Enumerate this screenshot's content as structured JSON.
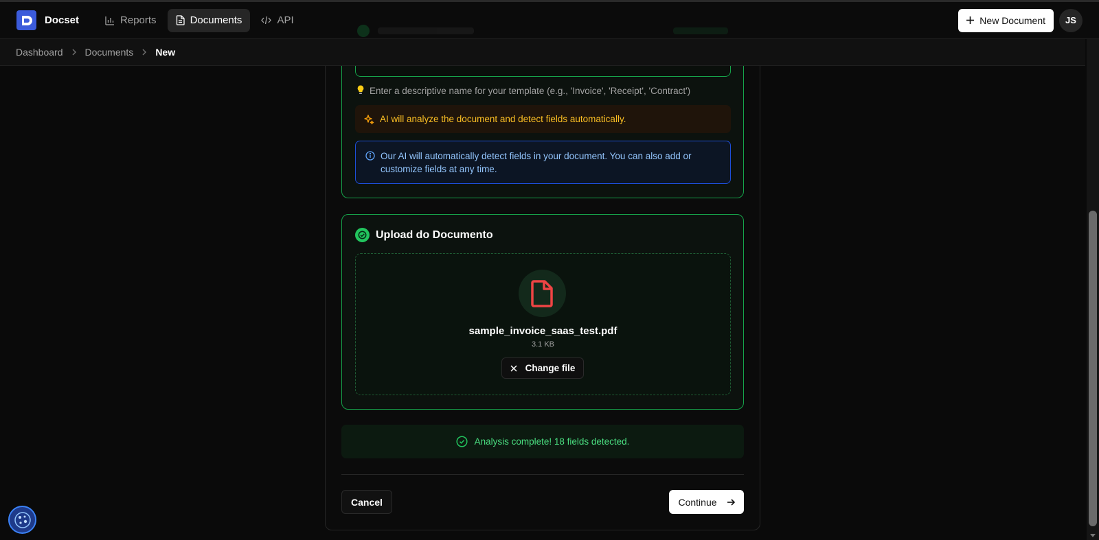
{
  "app": {
    "brand": "Docset",
    "logo_letter": "D"
  },
  "nav": {
    "items": [
      {
        "label": "Reports",
        "icon": "bar-chart-icon",
        "active": false
      },
      {
        "label": "Documents",
        "icon": "file-text-icon",
        "active": true
      },
      {
        "label": "API",
        "icon": "code-icon",
        "active": false
      }
    ],
    "new_document_label": "New Document",
    "avatar_initials": "JS"
  },
  "breadcrumb": {
    "items": [
      "Dashboard",
      "Documents"
    ],
    "current": "New"
  },
  "template_section": {
    "hint": "Enter a descriptive name for your template (e.g., 'Invoice', 'Receipt', 'Contract')",
    "ai_banner": "AI will analyze the document and detect fields automatically.",
    "info": "Our AI will automatically detect fields in your document. You can also add or customize fields at any time."
  },
  "upload_section": {
    "title": "Upload do Documento",
    "file_name": "sample_invoice_saas_test.pdf",
    "file_size": "3.1 KB",
    "change_file_label": "Change file"
  },
  "status": {
    "message": "Analysis complete! 18 fields detected."
  },
  "actions": {
    "cancel_label": "Cancel",
    "continue_label": "Continue"
  },
  "colors": {
    "accent_green": "#16a34a",
    "success_text": "#4ade80",
    "warning_text": "#fbbf24",
    "info_text": "#93c5fd",
    "file_red": "#ef4444",
    "brand_blue": "#3b5bdb"
  }
}
